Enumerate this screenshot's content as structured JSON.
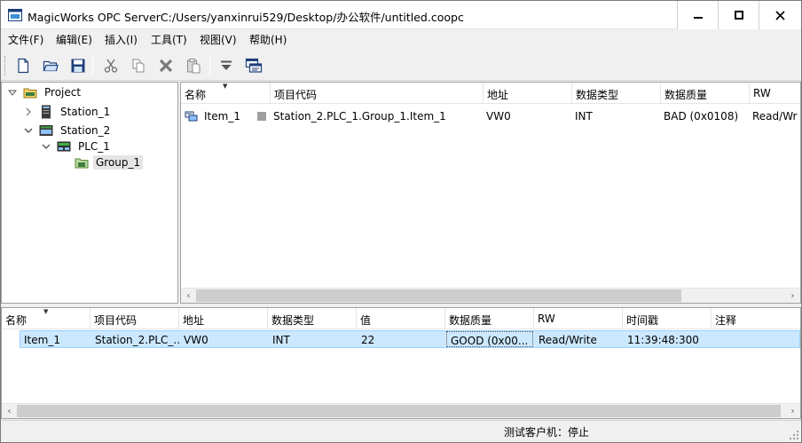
{
  "window": {
    "title": "MagicWorks OPC ServerC:/Users/yanxinrui529/Desktop/办公软件/untitled.coopc",
    "minimize_glyph": "—",
    "maximize_glyph": "☐",
    "close_glyph": "✕"
  },
  "menu": [
    "文件(F)",
    "编辑(E)",
    "插入(I)",
    "工具(T)",
    "视图(V)",
    "帮助(H)"
  ],
  "toolbar": {
    "icons": [
      "new-file-icon",
      "open-folder-icon",
      "save-icon",
      "cut-icon",
      "copy-icon",
      "delete-icon",
      "paste-icon",
      "filter-icon",
      "monitor-icon"
    ]
  },
  "tree": {
    "nodes": [
      {
        "label": "Project",
        "icon": "project-folder-icon",
        "expander": "▾"
      },
      {
        "label": "Station_1",
        "icon": "station-icon",
        "expander": "›"
      },
      {
        "label": "Station_2",
        "icon": "station-icon",
        "expander": "⌄"
      },
      {
        "label": "PLC_1",
        "icon": "plc-icon",
        "expander": "⌄"
      },
      {
        "label": "Group_1",
        "icon": "group-folder-icon",
        "expander": ""
      }
    ]
  },
  "item_list": {
    "columns": [
      "名称",
      "项目代码",
      "地址",
      "数据类型",
      "数据质量",
      "RW"
    ],
    "sort_indicator": "▼",
    "rows": [
      {
        "name": "Item_1",
        "code": "Station_2.PLC_1.Group_1.Item_1",
        "address": "VW0",
        "type": "INT",
        "quality": "BAD (0x0108)",
        "rw": "Read/Wr"
      }
    ]
  },
  "monitor": {
    "columns": [
      "名称",
      "项目代码",
      "地址",
      "数据类型",
      "值",
      "数据质量",
      "RW",
      "时间戳",
      "注释"
    ],
    "sort_indicator": "▼",
    "rows": [
      {
        "name": "Item_1",
        "code": "Station_2.PLC_...",
        "address": "VW0",
        "type": "INT",
        "value": "22",
        "quality": "GOOD  (0x00...",
        "rw": "Read/Write",
        "timestamp": "11:39:48:300",
        "note": ""
      }
    ]
  },
  "scroll": {
    "left": "‹",
    "right": "›"
  },
  "status": {
    "text": "测试客户机：停止"
  },
  "colors": {
    "selection": "#cce8ff",
    "selection_border": "#99d1ff",
    "bad_marker": "#a0a0a0"
  }
}
